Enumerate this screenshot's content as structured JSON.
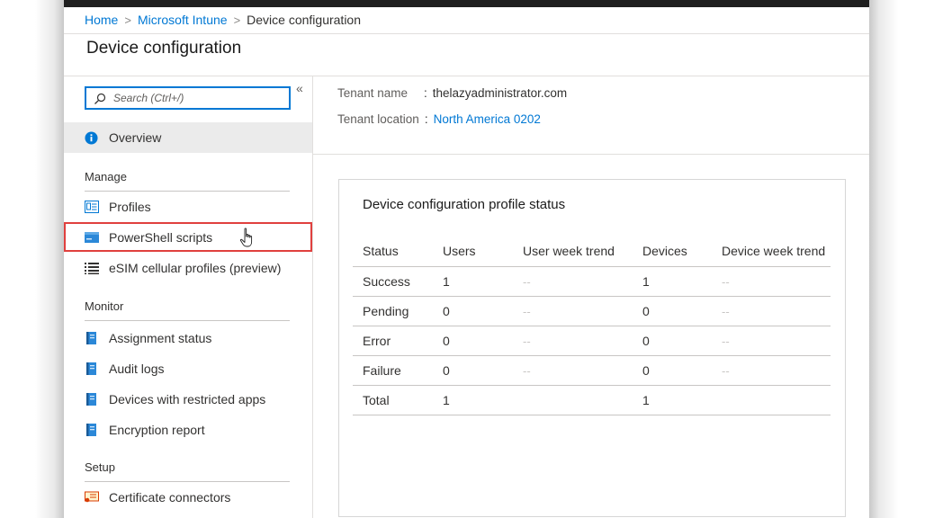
{
  "breadcrumb": {
    "items": [
      {
        "label": "Home"
      },
      {
        "label": "Microsoft Intune"
      },
      {
        "label": "Device configuration"
      }
    ]
  },
  "page": {
    "title": "Device configuration"
  },
  "sidebar": {
    "search_placeholder": "Search (Ctrl+/)",
    "collapse_icon": "«",
    "overview": {
      "label": "Overview",
      "icon": "info-icon"
    },
    "sections": {
      "manage": "Manage",
      "monitor": "Monitor",
      "setup": "Setup"
    },
    "manage_items": [
      {
        "label": "Profiles",
        "icon": "profiles-icon"
      },
      {
        "label": "PowerShell scripts",
        "icon": "powershell-icon"
      },
      {
        "label": "eSIM cellular profiles (preview)",
        "icon": "list-icon"
      }
    ],
    "monitor_items": [
      {
        "label": "Assignment status",
        "icon": "report-icon"
      },
      {
        "label": "Audit logs",
        "icon": "report-icon"
      },
      {
        "label": "Devices with restricted apps",
        "icon": "report-icon"
      },
      {
        "label": "Encryption report",
        "icon": "report-icon"
      }
    ],
    "setup_items": [
      {
        "label": "Certificate connectors",
        "icon": "certificate-icon"
      }
    ]
  },
  "essentials": {
    "tenant_name_key": "Tenant name",
    "tenant_name_value": "thelazyadministrator.com",
    "tenant_location_key": "Tenant location",
    "tenant_location_value": "North America 0202",
    "colon": ":"
  },
  "status_card": {
    "title": "Device configuration profile status",
    "headers": [
      "Status",
      "Users",
      "User week trend",
      "Devices",
      "Device week trend"
    ],
    "rows": [
      [
        "Success",
        "1",
        "--",
        "1",
        "--"
      ],
      [
        "Pending",
        "0",
        "--",
        "0",
        "--"
      ],
      [
        "Error",
        "0",
        "--",
        "0",
        "--"
      ],
      [
        "Failure",
        "0",
        "--",
        "0",
        "--"
      ],
      [
        "Total",
        "1",
        "",
        "1",
        ""
      ]
    ]
  },
  "colors": {
    "accent": "#0078d4",
    "highlight_border": "#e0403e",
    "selected_bg": "#ebebeb"
  }
}
